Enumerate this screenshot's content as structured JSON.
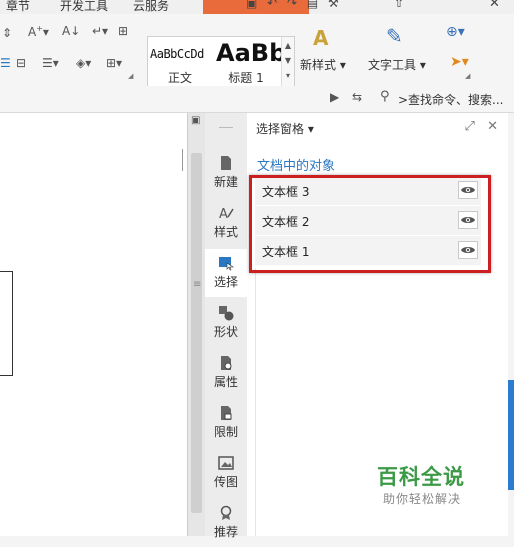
{
  "menu": {
    "tabs": [
      "章节",
      "开发工具",
      "云服务"
    ]
  },
  "ribbon": {
    "styles": [
      {
        "sample": "AaBbCcDd",
        "name": "正文"
      },
      {
        "sample": "AaBb",
        "name": "标题 1"
      }
    ],
    "new_style_label": "新样式",
    "text_tools_label": "文字工具",
    "search_placeholder": ">查找命令、搜索..."
  },
  "side_tabs": [
    {
      "label": "新建",
      "icon": "new-document-icon"
    },
    {
      "label": "样式",
      "icon": "style-icon"
    },
    {
      "label": "选择",
      "icon": "select-icon",
      "active": true
    },
    {
      "label": "形状",
      "icon": "shape-icon"
    },
    {
      "label": "属性",
      "icon": "properties-icon"
    },
    {
      "label": "限制",
      "icon": "restrict-icon"
    },
    {
      "label": "传图",
      "icon": "upload-image-icon"
    },
    {
      "label": "推荐",
      "icon": "recommend-icon"
    }
  ],
  "pane": {
    "title": "选择窗格",
    "section_title": "文档中的对象",
    "objects": [
      "文本框 3",
      "文本框 2",
      "文本框 1"
    ]
  },
  "watermark": {
    "title": "百科全说",
    "subtitle": "助你轻松解决"
  },
  "colors": {
    "highlight": "#cc1f1f",
    "accent_blue": "#2b78c2",
    "watermark_green": "#3c9a46",
    "orange_tab": "#e96a3b"
  }
}
